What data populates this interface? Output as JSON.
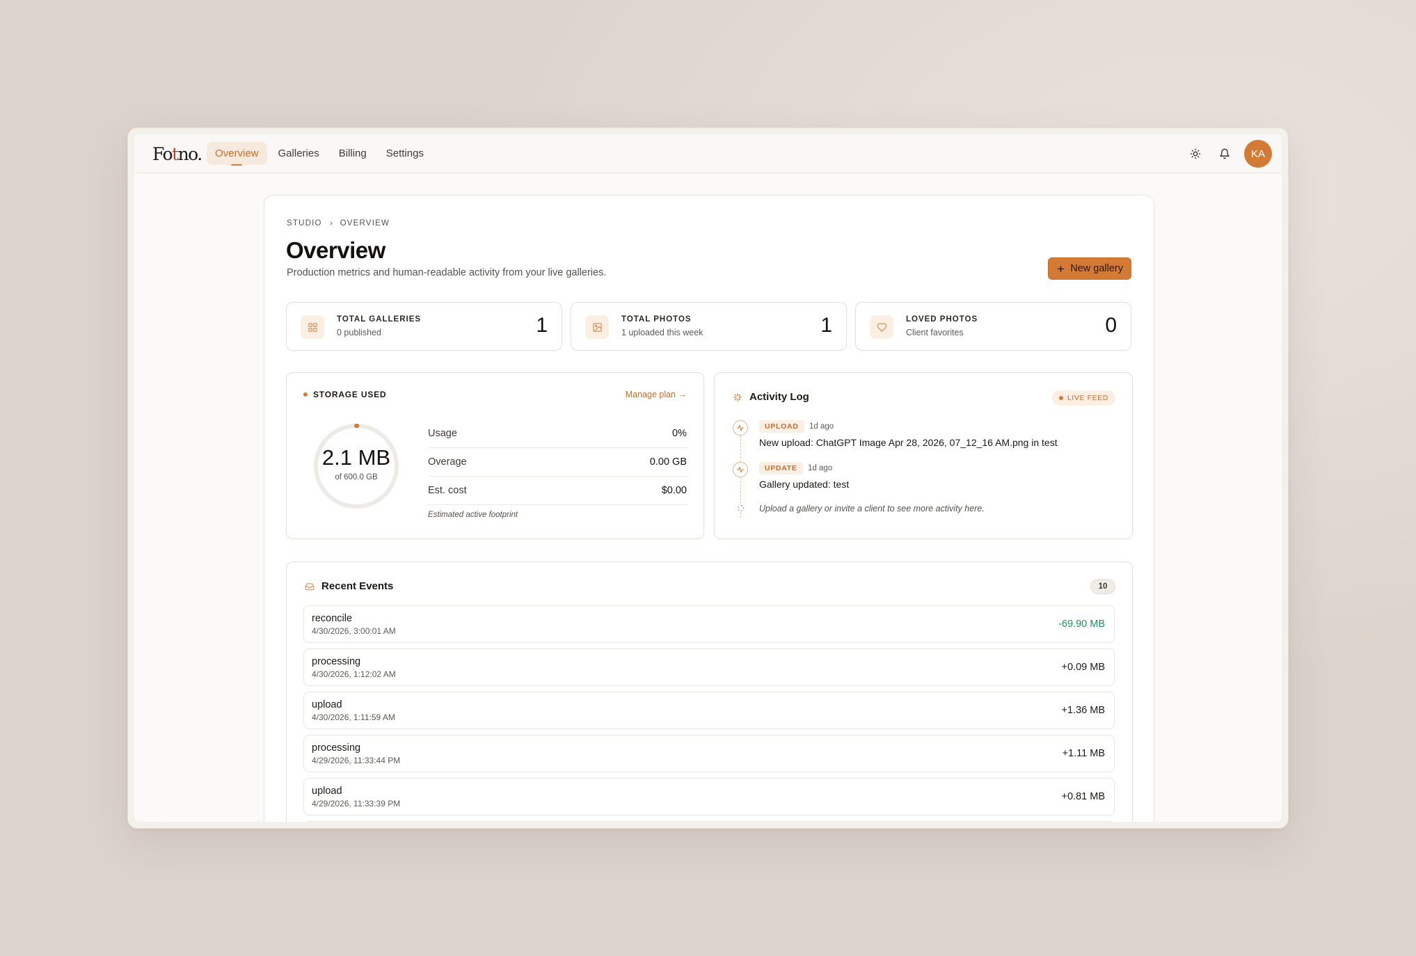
{
  "brand": {
    "logo_pre": "Fo",
    "logo_accent": "t",
    "logo_post": "no."
  },
  "nav": {
    "tabs": [
      {
        "label": "Overview",
        "active": true
      },
      {
        "label": "Galleries",
        "active": false
      },
      {
        "label": "Billing",
        "active": false
      },
      {
        "label": "Settings",
        "active": false
      }
    ],
    "avatar_initials": "KA"
  },
  "breadcrumb": {
    "root": "STUDIO",
    "current": "OVERVIEW"
  },
  "header": {
    "title": "Overview",
    "subtitle": "Production metrics and human-readable activity from your live galleries.",
    "new_gallery_label": "New gallery"
  },
  "stats": [
    {
      "label": "TOTAL GALLERIES",
      "sub": "0 published",
      "value": "1",
      "icon": "grid-icon"
    },
    {
      "label": "TOTAL PHOTOS",
      "sub": "1 uploaded this week",
      "value": "1",
      "icon": "image-icon"
    },
    {
      "label": "LOVED PHOTOS",
      "sub": "Client favorites",
      "value": "0",
      "icon": "heart-icon"
    }
  ],
  "storage": {
    "title": "STORAGE USED",
    "manage_label": "Manage plan →",
    "used": "2.1 MB",
    "of": "of 600.0 GB",
    "usage_fraction": 0.0035,
    "metrics": [
      {
        "key": "Usage",
        "value": "0%"
      },
      {
        "key": "Overage",
        "value": "0.00 GB"
      },
      {
        "key": "Est. cost",
        "value": "$0.00"
      }
    ],
    "footnote": "Estimated active footprint"
  },
  "activity": {
    "title": "Activity Log",
    "badge": "LIVE FEED",
    "events": [
      {
        "tag": "UPLOAD",
        "ago": "1d ago",
        "message": "New upload: ChatGPT Image Apr 28, 2026, 07_12_16 AM.png in test"
      },
      {
        "tag": "UPDATE",
        "ago": "1d ago",
        "message": "Gallery updated: test"
      }
    ],
    "hint": "Upload a gallery or invite a client to see more activity here."
  },
  "recent": {
    "title": "Recent Events",
    "count": "10",
    "rows": [
      {
        "name": "reconcile",
        "time": "4/30/2026, 3:00:01 AM",
        "delta": "-69.90 MB",
        "negative": true
      },
      {
        "name": "processing",
        "time": "4/30/2026, 1:12:02 AM",
        "delta": "+0.09 MB",
        "negative": false
      },
      {
        "name": "upload",
        "time": "4/30/2026, 1:11:59 AM",
        "delta": "+1.36 MB",
        "negative": false
      },
      {
        "name": "processing",
        "time": "4/29/2026, 11:33:44 PM",
        "delta": "+1.11 MB",
        "negative": false
      },
      {
        "name": "upload",
        "time": "4/29/2026, 11:33:39 PM",
        "delta": "+0.81 MB",
        "negative": false
      }
    ]
  },
  "colors": {
    "accent": "#d37a35",
    "positive_green": "#1f8f5f"
  }
}
